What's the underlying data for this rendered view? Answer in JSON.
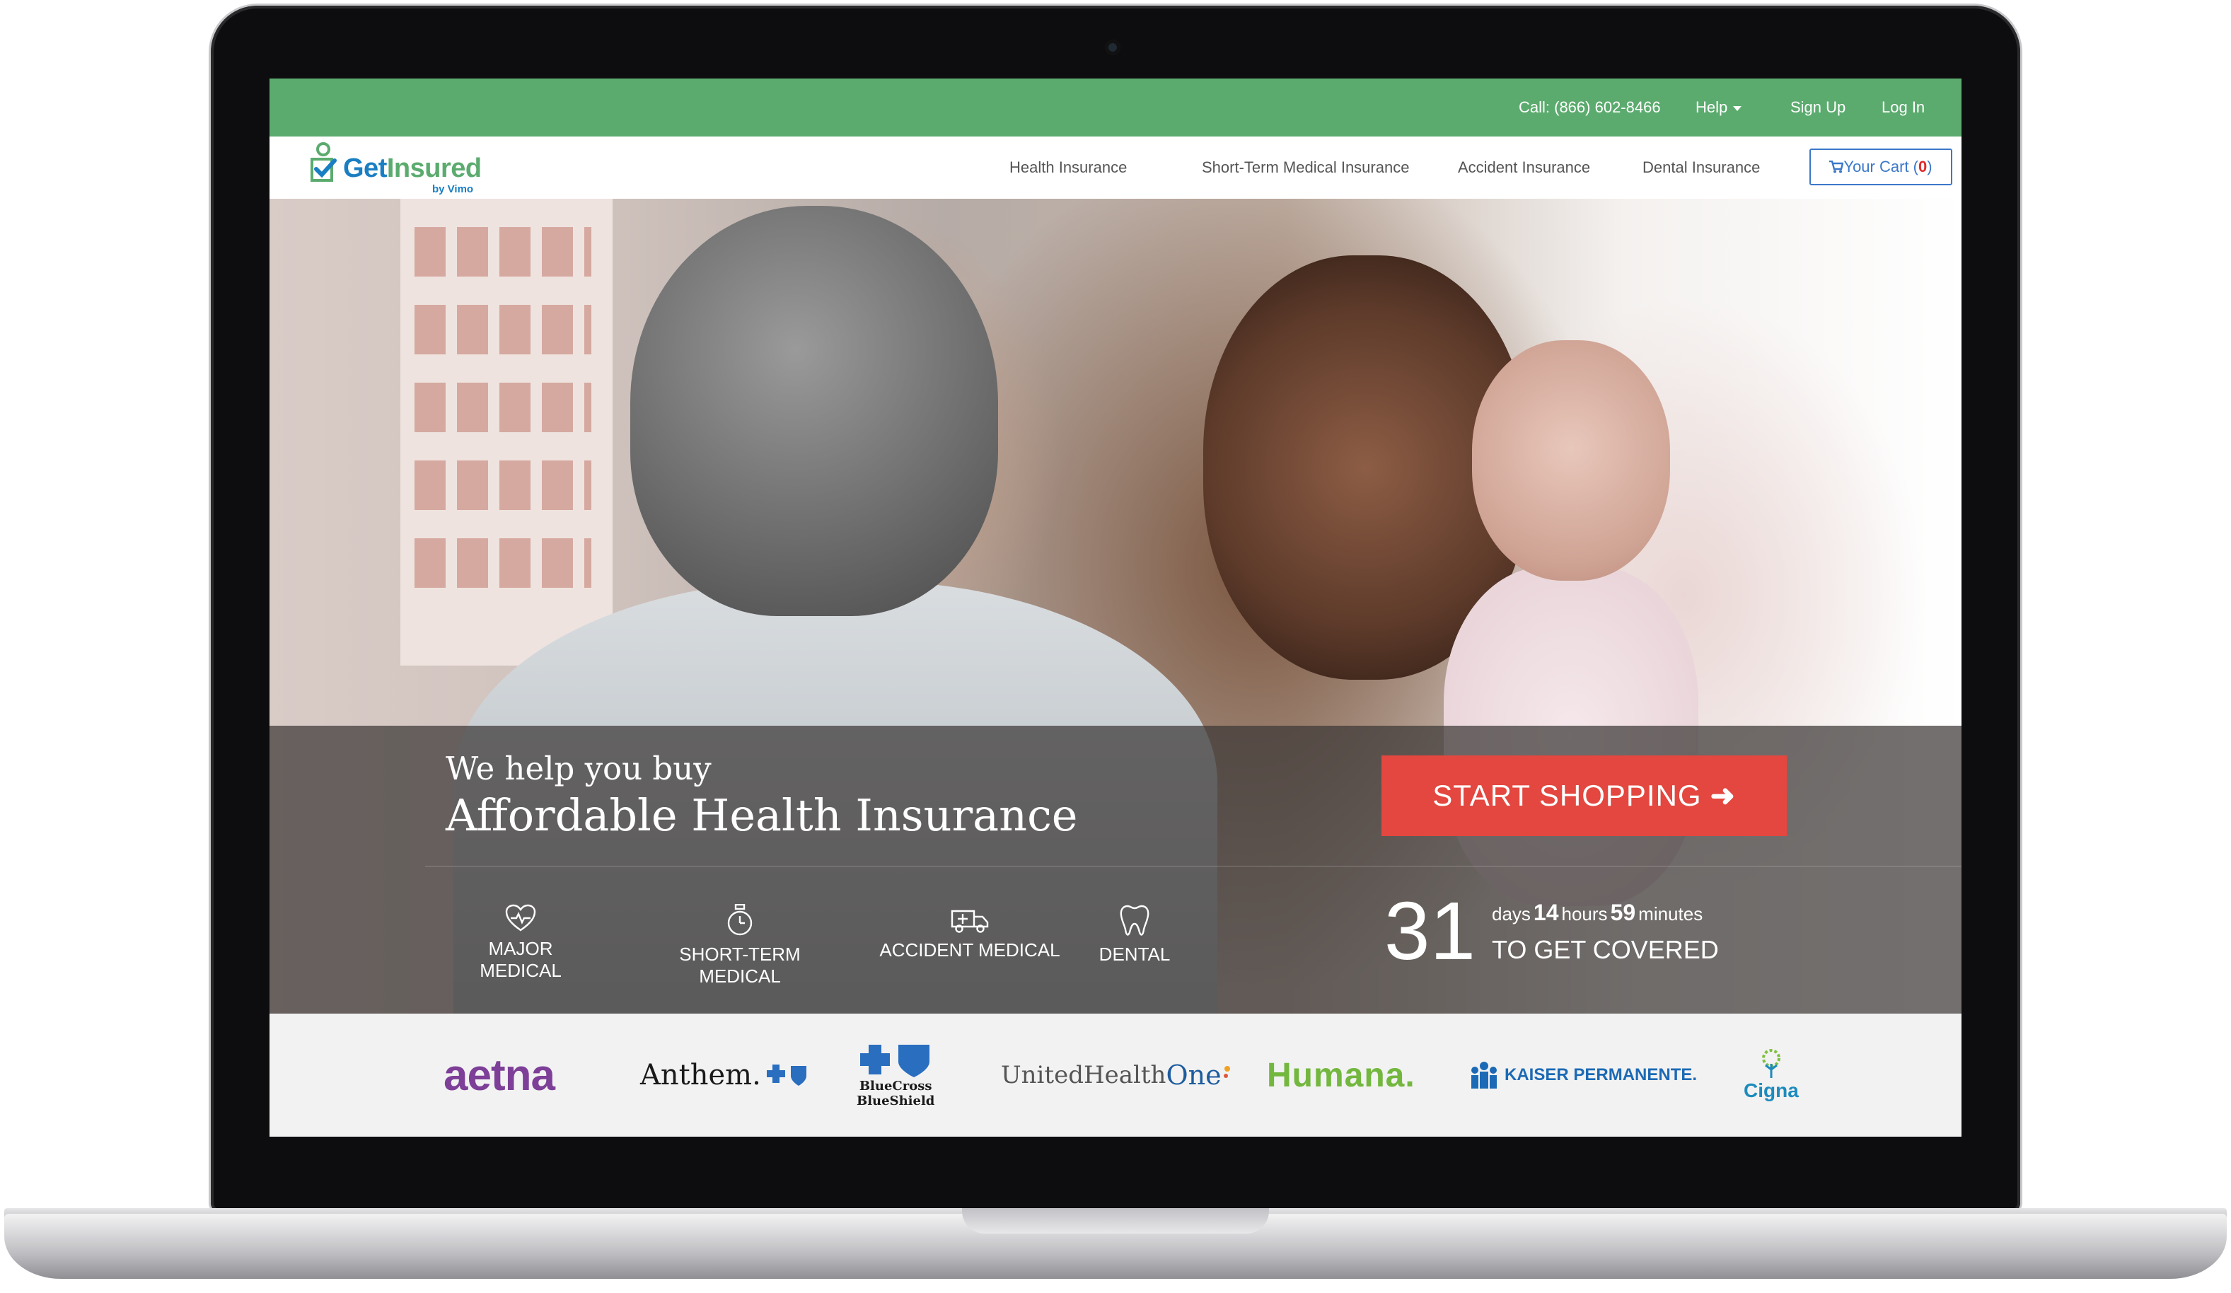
{
  "header": {
    "phone": "Call: (866) 602-8466",
    "help": "Help",
    "sign_up": "Sign Up",
    "log_in": "Log In"
  },
  "brand": {
    "name_part1": "Get",
    "name_part2": "Insured",
    "byline": "by Vimo",
    "colors": {
      "green": "#5bab6e",
      "blue": "#1a7ec2",
      "cta": "#e3473f"
    }
  },
  "nav": {
    "items": [
      {
        "label": "Health Insurance"
      },
      {
        "label": "Short-Term Medical Insurance"
      },
      {
        "label": "Accident Insurance"
      },
      {
        "label": "Dental Insurance"
      }
    ],
    "cart_label": "Your Cart (",
    "cart_count": "0",
    "cart_close": ")"
  },
  "hero": {
    "subheading": "We help you buy",
    "heading": "Affordable Health Insurance",
    "cta": "START SHOPPING",
    "categories": [
      {
        "label": "MAJOR MEDICAL",
        "icon": "heart-pulse-icon"
      },
      {
        "label": "SHORT-TERM MEDICAL",
        "icon": "stopwatch-icon"
      },
      {
        "label": "ACCIDENT MEDICAL",
        "icon": "ambulance-icon"
      },
      {
        "label": "DENTAL",
        "icon": "tooth-icon"
      }
    ],
    "countdown": {
      "days": "31",
      "days_label": "days",
      "hours": "14",
      "hours_label": "hours",
      "minutes": "59",
      "minutes_label": "minutes",
      "tagline": "TO GET COVERED"
    }
  },
  "partners": [
    {
      "name": "aetna"
    },
    {
      "name": "Anthem."
    },
    {
      "name_line1": "BlueCross",
      "name_line2": "BlueShield"
    },
    {
      "name_part1": "UnitedHealth",
      "name_part2": "One"
    },
    {
      "name": "Humana."
    },
    {
      "name": "KAISER PERMANENTE."
    },
    {
      "name": "Cigna"
    }
  ]
}
